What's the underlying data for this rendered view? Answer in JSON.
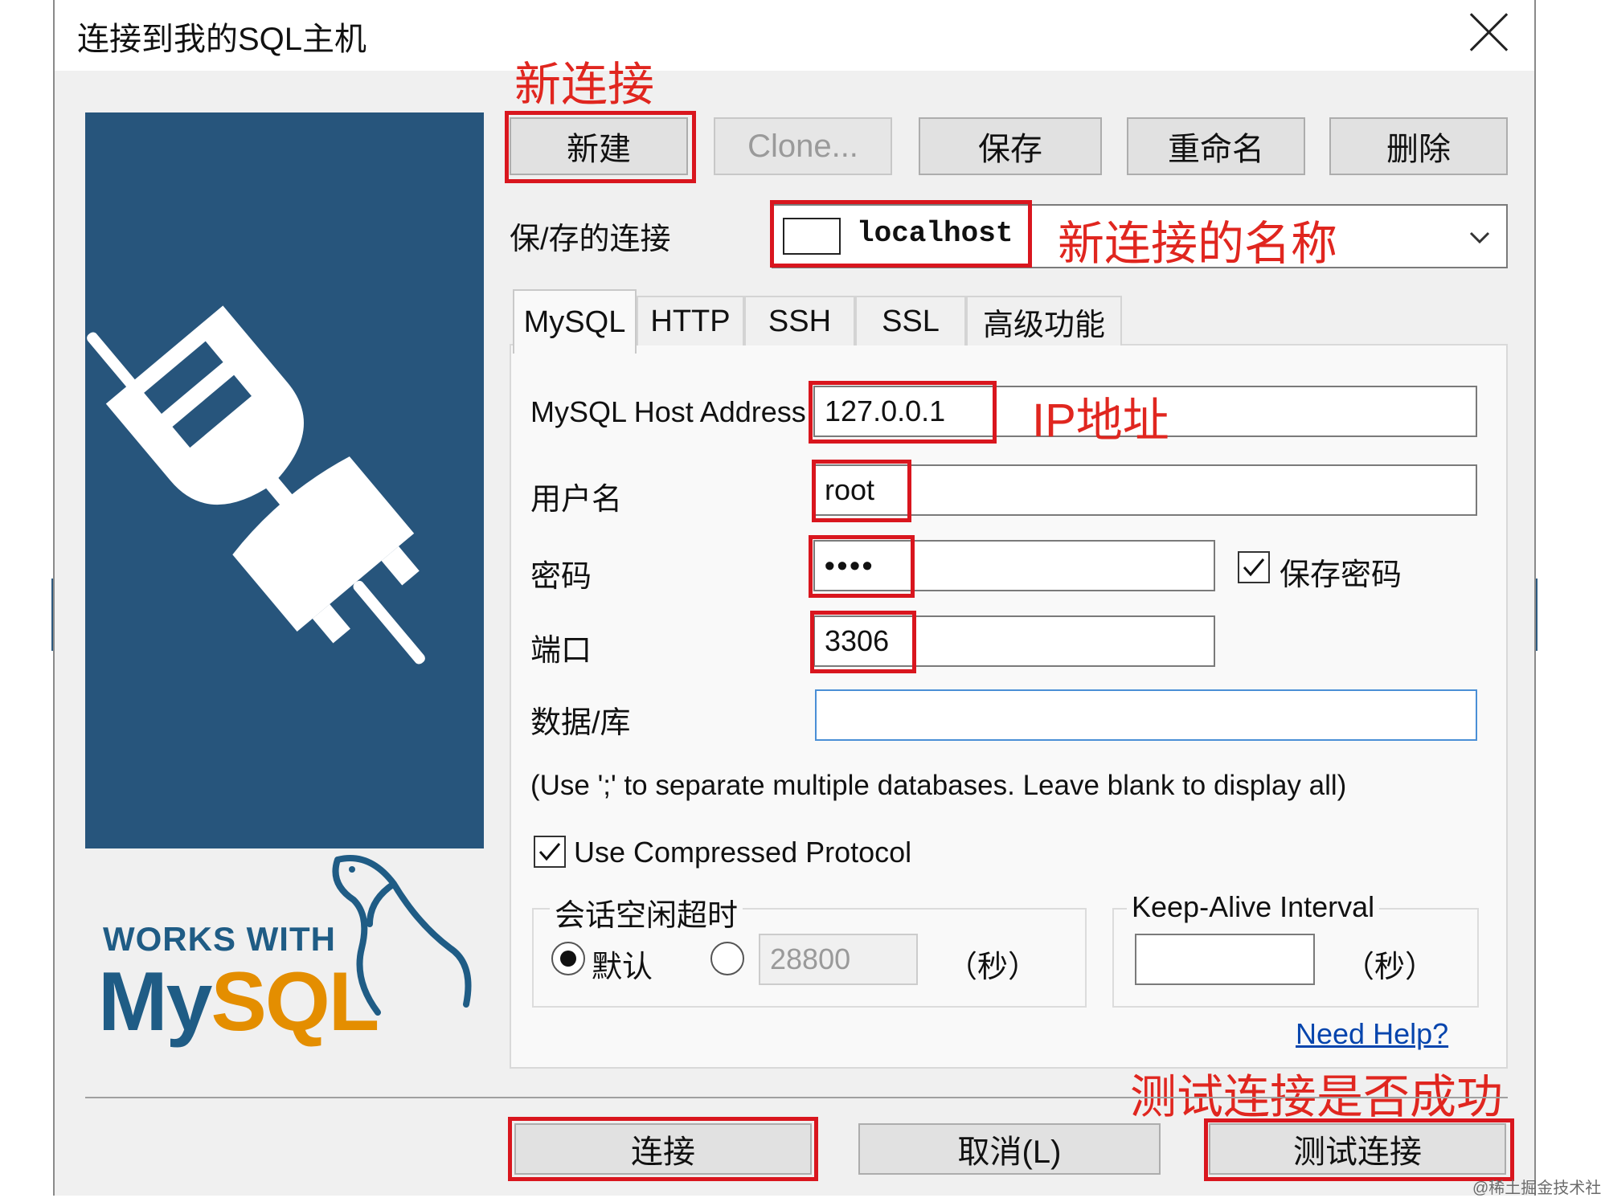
{
  "window": {
    "title": "连接到我的SQL主机"
  },
  "logo": {
    "works_with": "WORKS WITH",
    "brand_my": "My",
    "brand_sql": "SQL",
    "plug_icon": "plug-connect-icon",
    "dolphin_icon": "mysql-dolphin-icon"
  },
  "toolbar": {
    "new": "新建",
    "clone": "Clone...",
    "save": "保存",
    "rename": "重命名",
    "delete": "删除"
  },
  "saved_connections": {
    "label": "保/存的连接",
    "value": "localhost"
  },
  "tabs": [
    {
      "label": "MySQL",
      "active": true
    },
    {
      "label": "HTTP",
      "active": false
    },
    {
      "label": "SSH",
      "active": false
    },
    {
      "label": "SSL",
      "active": false
    },
    {
      "label": "高级功能",
      "active": false
    }
  ],
  "form": {
    "host": {
      "label": "MySQL Host Address",
      "value": "127.0.0.1"
    },
    "user": {
      "label": "用户名",
      "value": "root"
    },
    "password": {
      "label": "密码",
      "value": "••••"
    },
    "save_password": {
      "label": "保存密码",
      "checked": true
    },
    "port": {
      "label": "端口",
      "value": "3306"
    },
    "database": {
      "label": "数据/库",
      "value": ""
    },
    "hint": "(Use ';' to separate multiple databases. Leave blank to display all)",
    "compressed": {
      "label": "Use Compressed Protocol",
      "checked": true
    }
  },
  "session_timeout": {
    "title": "会话空闲超时",
    "default_label": "默认",
    "default_selected": true,
    "value": "28800",
    "unit": "（秒）"
  },
  "keepalive": {
    "title": "Keep-Alive Interval",
    "value": "",
    "unit": "（秒）"
  },
  "help_link": "Need Help?",
  "footer": {
    "connect": "连接",
    "cancel": "取消(L)",
    "test": "测试连接"
  },
  "annotations": {
    "new_connection": "新连接",
    "connection_name": "新连接的名称",
    "ip_address": "IP地址",
    "test_success": "测试连接是否成功"
  },
  "watermark": "@稀土掘金技术社区",
  "colors": {
    "annotation_red": "#d9161e",
    "logo_blue": "#27557c",
    "mysql_orange": "#e48e00",
    "link_blue": "#0645ad"
  }
}
